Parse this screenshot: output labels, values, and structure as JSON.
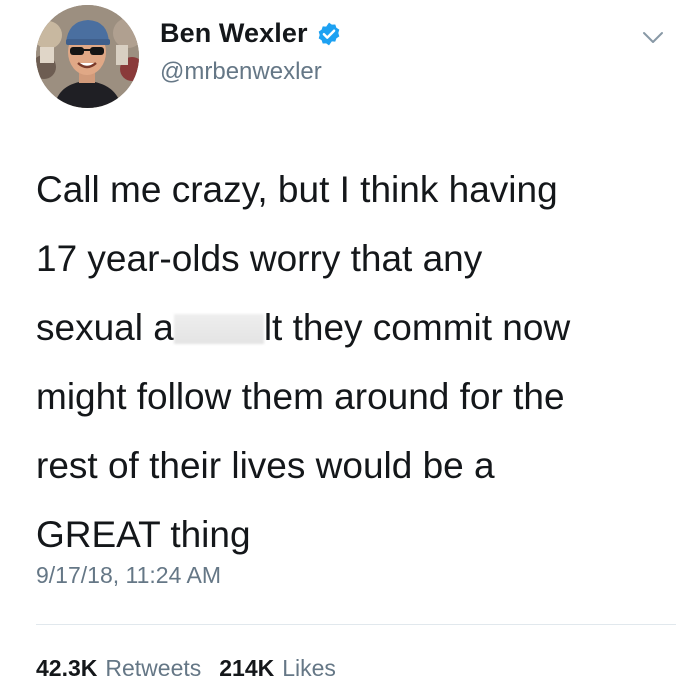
{
  "author": {
    "display_name": "Ben Wexler",
    "handle": "@mrbenwexler",
    "verified": true
  },
  "tweet": {
    "line_1": "Call me crazy, but I think having",
    "line_2": "17 year-olds worry that any",
    "line_3_before_redaction": "sexual a",
    "line_3_after_redaction": "lt they commit now",
    "line_4": "might follow them around for the",
    "line_5": "rest of their lives would be a",
    "line_6": "GREAT thing",
    "timestamp": "9/17/18, 11:24 AM"
  },
  "stats": {
    "retweets_count": "42.3K",
    "retweets_label": "Retweets",
    "likes_count": "214K",
    "likes_label": "Likes"
  },
  "colors": {
    "verified_blue": "#1da1f2",
    "secondary_text": "#657786",
    "primary_text": "#14171a",
    "divider": "#e1e8ed"
  },
  "icons": {
    "verified": "verified-badge-icon",
    "menu": "chevron-down-icon"
  }
}
